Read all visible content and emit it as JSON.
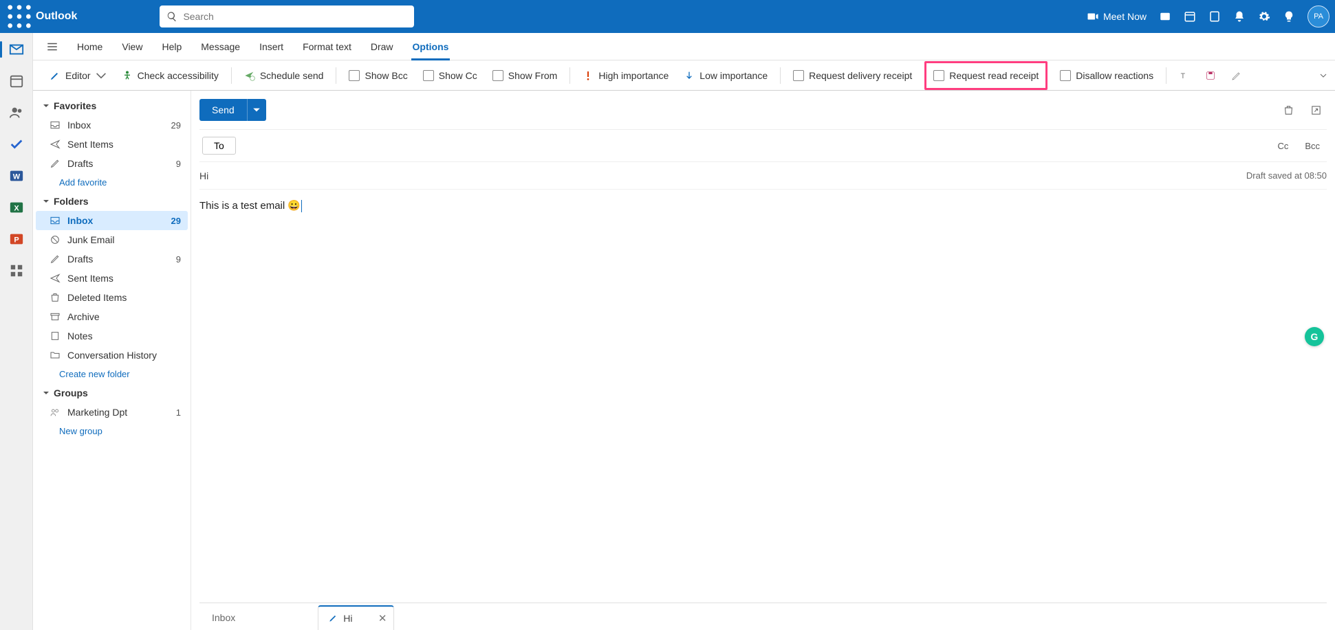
{
  "titlebar": {
    "brand": "Outlook",
    "search_placeholder": "Search",
    "meet_now": "Meet Now",
    "avatar_initials": "PA"
  },
  "tabs": {
    "home": "Home",
    "view": "View",
    "help": "Help",
    "message": "Message",
    "insert": "Insert",
    "format_text": "Format text",
    "draw": "Draw",
    "options": "Options"
  },
  "ribbon": {
    "editor": "Editor",
    "check_accessibility": "Check accessibility",
    "schedule_send": "Schedule send",
    "show_bcc": "Show Bcc",
    "show_cc": "Show Cc",
    "show_from": "Show From",
    "high_importance": "High importance",
    "low_importance": "Low importance",
    "request_delivery_receipt": "Request delivery receipt",
    "request_read_receipt": "Request read receipt",
    "disallow_reactions": "Disallow reactions"
  },
  "folders": {
    "favorites_hdr": "Favorites",
    "fav_inbox": "Inbox",
    "fav_inbox_count": "29",
    "fav_sent": "Sent Items",
    "fav_drafts": "Drafts",
    "fav_drafts_count": "9",
    "add_favorite": "Add favorite",
    "folders_hdr": "Folders",
    "f_inbox": "Inbox",
    "f_inbox_count": "29",
    "f_junk": "Junk Email",
    "f_drafts": "Drafts",
    "f_drafts_count": "9",
    "f_sent": "Sent Items",
    "f_deleted": "Deleted Items",
    "f_archive": "Archive",
    "f_notes": "Notes",
    "f_conv": "Conversation History",
    "create_new_folder": "Create new folder",
    "groups_hdr": "Groups",
    "g_marketing": "Marketing Dpt",
    "g_marketing_count": "1",
    "new_group": "New group"
  },
  "compose": {
    "send": "Send",
    "to_label": "To",
    "cc": "Cc",
    "bcc": "Bcc",
    "subject_value": "Hi",
    "draft_saved": "Draft saved at 08:50",
    "body_text": "This is a test email ",
    "emoji": "😀"
  },
  "bottom": {
    "inbox": "Inbox",
    "draft_title": "Hi"
  }
}
